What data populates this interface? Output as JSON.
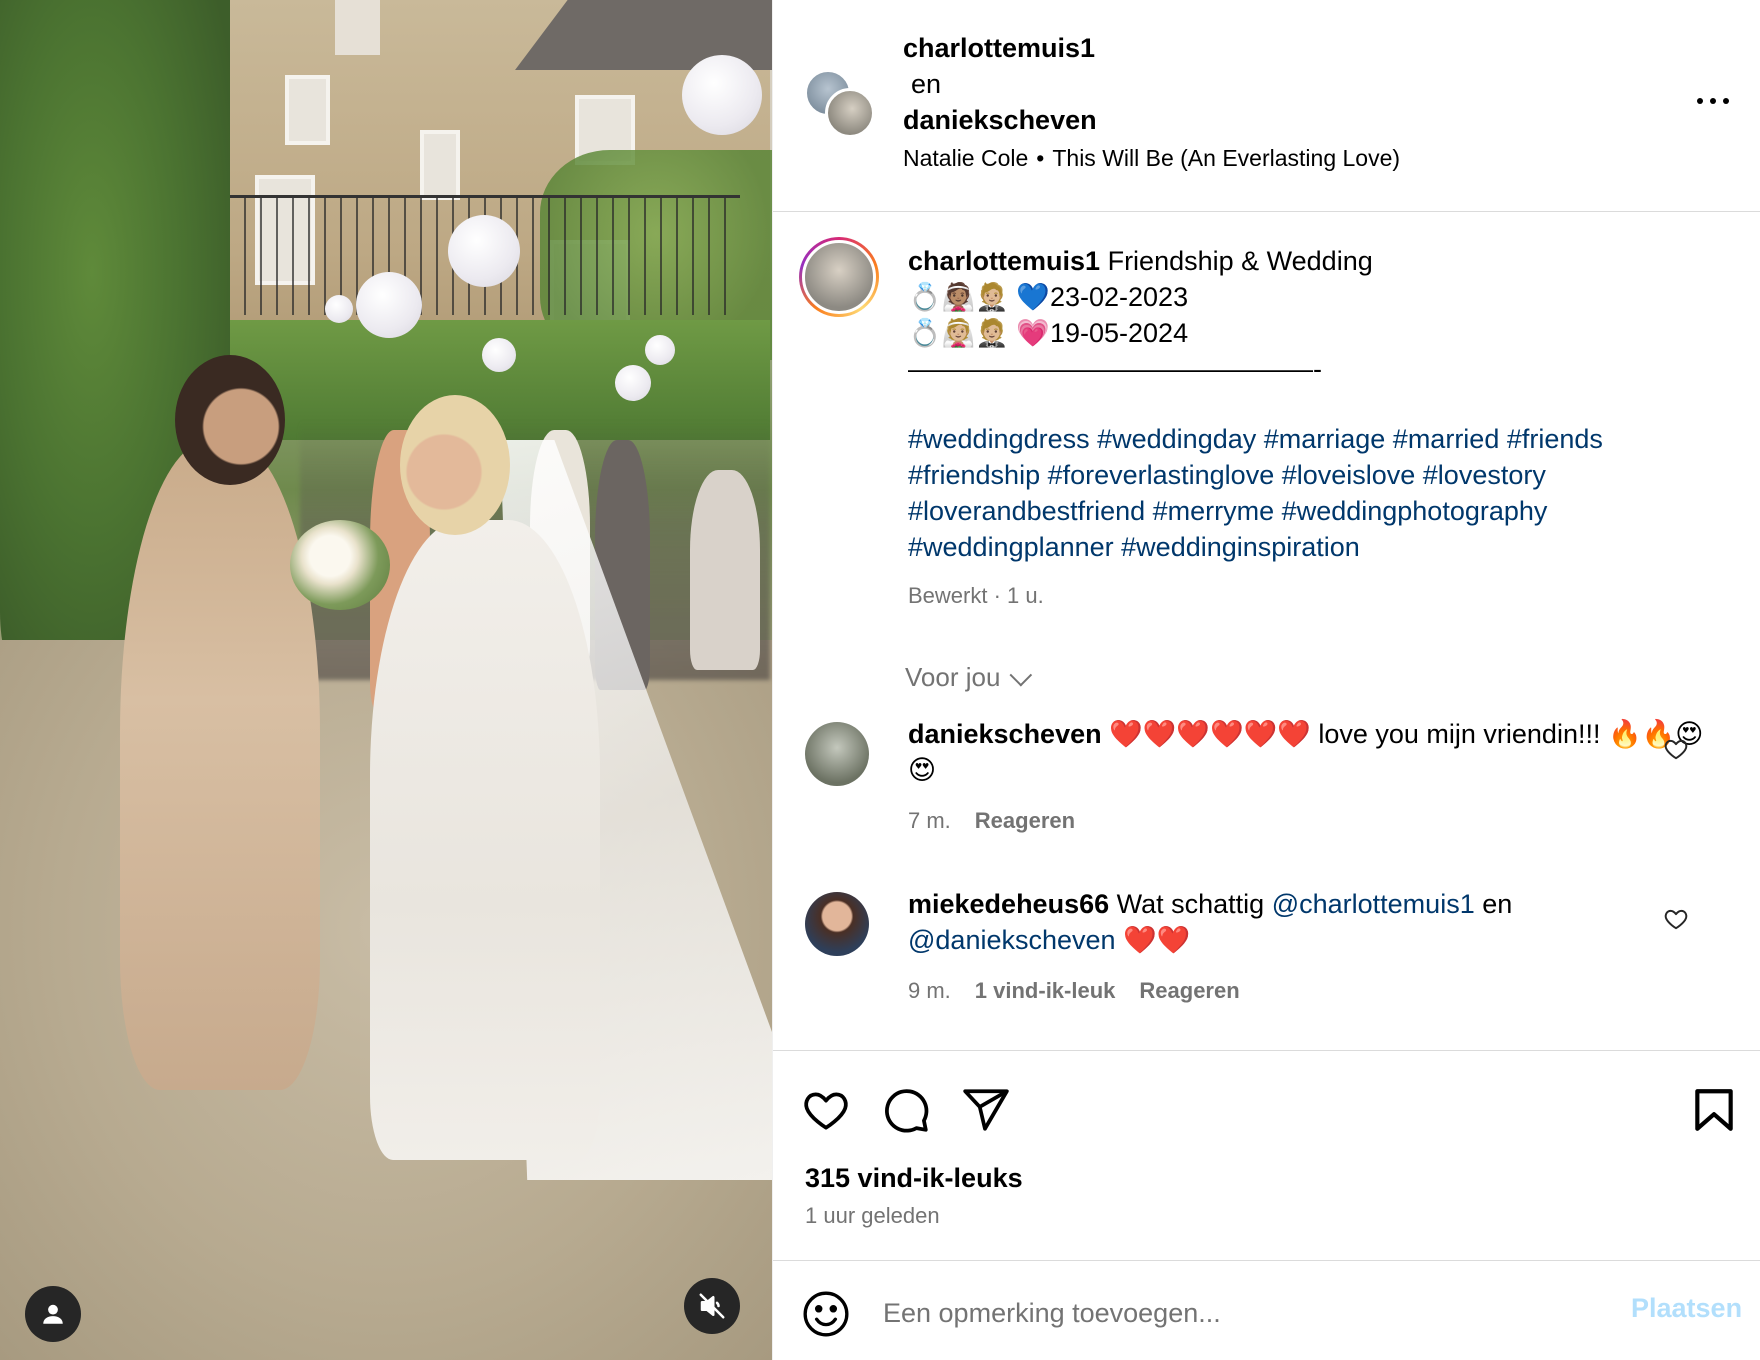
{
  "header": {
    "user1": "charlottemuis1",
    "connector": "en",
    "user2": "daniekscheven",
    "song_artist": "Natalie Cole",
    "song_separator": "•",
    "song_title": "This Will Be (An Everlasting Love)"
  },
  "caption": {
    "username": "charlottemuis1",
    "title": "Friendship & Wedding",
    "line1": "💍👰🏽🤵🏼 💙23-02-2023",
    "line2": "💍👰🏼🤵🏼 💗19-05-2024",
    "divider": "———————————————-",
    "hashtags_1": "#weddingdress #weddingday #marriage #married #friends",
    "hashtags_2": "#friendship #foreverlastinglove #loveislove #lovestory",
    "hashtags_3": "#loverandbestfriend #merryme #weddingphotography",
    "hashtags_4": "#weddingplanner #weddinginspiration",
    "meta": "Bewerkt · 1 u."
  },
  "voor_jou": "Voor jou",
  "comments": [
    {
      "username": "daniekscheven",
      "text": "❤️❤️❤️❤️❤️❤️ love you mijn vriendin!!! 🔥🔥😍😍",
      "time": "7 m.",
      "reply": "Reageren"
    },
    {
      "username": "miekedeheus66",
      "text_before": "Wat schattig",
      "mention1": "@charlottemuis1",
      "text_middle": "en",
      "mention2": "@daniekscheven",
      "text_after": "❤️❤️",
      "time": "9 m.",
      "likes": "1 vind-ik-leuk",
      "reply": "Reageren"
    }
  ],
  "actions": {
    "likes": "315 vind-ik-leuks",
    "time": "1 uur geleden"
  },
  "add_comment": {
    "placeholder": "Een opmerking toevoegen...",
    "post_label": "Plaatsen"
  },
  "icons": {
    "more": "more-horizontal-icon",
    "like": "heart-icon",
    "comment": "comment-icon",
    "share": "paper-plane-icon",
    "save": "bookmark-icon",
    "emoji": "smiley-icon",
    "mute": "speaker-muted-icon",
    "tagged_user": "user-icon"
  },
  "colors": {
    "link": "#00376b",
    "secondary_text": "#737373",
    "post_button_disabled": "#b2dffc",
    "border": "#dbdbdb"
  }
}
